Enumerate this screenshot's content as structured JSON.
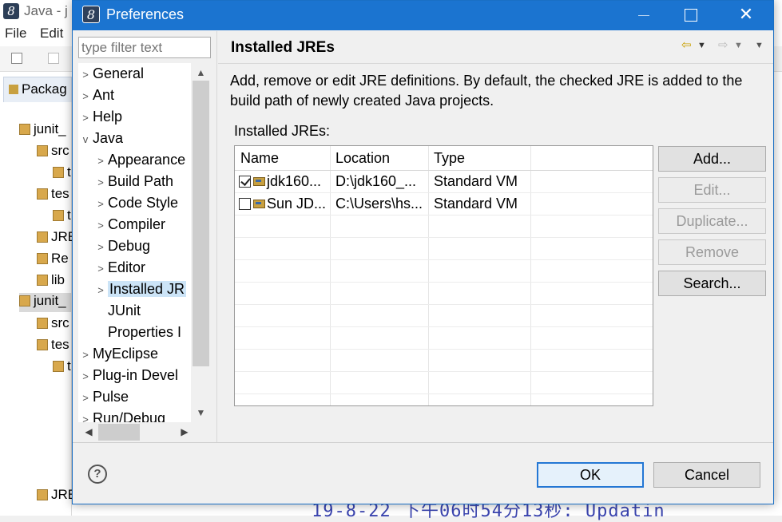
{
  "ide": {
    "title": "Java - j",
    "menu": [
      "File",
      "Edit"
    ],
    "package_tab": "Packag",
    "tree": [
      {
        "label": "junit_",
        "selected": false
      },
      {
        "label": "src",
        "selected": false
      },
      {
        "label": "t",
        "selected": false
      },
      {
        "label": "tes",
        "selected": false
      },
      {
        "label": "t",
        "selected": false
      },
      {
        "label": "JRE",
        "selected": false
      },
      {
        "label": "Re",
        "selected": false
      },
      {
        "label": "lib",
        "selected": false
      },
      {
        "label": "junit_",
        "selected": true
      },
      {
        "label": "src",
        "selected": false
      },
      {
        "label": "tes",
        "selected": false
      },
      {
        "label": "t",
        "selected": false
      },
      {
        "label": "JRE",
        "selected": false
      }
    ],
    "console_text": "19-8-22 下午06时54分13秒: Updatin"
  },
  "dialog": {
    "title": "Preferences",
    "filter_placeholder": "type filter text",
    "nav": [
      {
        "label": "General",
        "expanded": false,
        "depth": 0
      },
      {
        "label": "Ant",
        "expanded": false,
        "depth": 0
      },
      {
        "label": "Help",
        "expanded": false,
        "depth": 0
      },
      {
        "label": "Java",
        "expanded": true,
        "depth": 0
      },
      {
        "label": "Appearance",
        "expanded": false,
        "depth": 1
      },
      {
        "label": "Build Path",
        "expanded": false,
        "depth": 1
      },
      {
        "label": "Code Style",
        "expanded": false,
        "depth": 1
      },
      {
        "label": "Compiler",
        "expanded": false,
        "depth": 1
      },
      {
        "label": "Debug",
        "expanded": false,
        "depth": 1
      },
      {
        "label": "Editor",
        "expanded": false,
        "depth": 1
      },
      {
        "label": "Installed JR",
        "expanded": false,
        "depth": 1,
        "selected": true
      },
      {
        "label": "JUnit",
        "leaf": true,
        "depth": 1
      },
      {
        "label": "Properties I",
        "leaf": true,
        "depth": 1
      },
      {
        "label": "MyEclipse",
        "expanded": false,
        "depth": 0
      },
      {
        "label": "Plug-in Devel",
        "expanded": false,
        "depth": 0
      },
      {
        "label": "Pulse",
        "expanded": false,
        "depth": 0
      },
      {
        "label": "Run/Debug",
        "expanded": false,
        "depth": 0
      }
    ],
    "page": {
      "title": "Installed JREs",
      "description": "Add, remove or edit JRE definitions. By default, the checked JRE is added to the build path of newly created Java projects.",
      "table_label": "Installed JREs:",
      "columns": [
        "Name",
        "Location",
        "Type"
      ],
      "rows": [
        {
          "checked": true,
          "name": "jdk160...",
          "location": "D:\\jdk160_...",
          "type": "Standard VM"
        },
        {
          "checked": false,
          "name": "Sun JD...",
          "location": "C:\\Users\\hs...",
          "type": "Standard VM"
        }
      ],
      "buttons": [
        {
          "label": "Add...",
          "enabled": true
        },
        {
          "label": "Edit...",
          "enabled": false
        },
        {
          "label": "Duplicate...",
          "enabled": false
        },
        {
          "label": "Remove",
          "enabled": false
        },
        {
          "label": "Search...",
          "enabled": true
        }
      ]
    },
    "ok_label": "OK",
    "cancel_label": "Cancel",
    "help_glyph": "?"
  }
}
